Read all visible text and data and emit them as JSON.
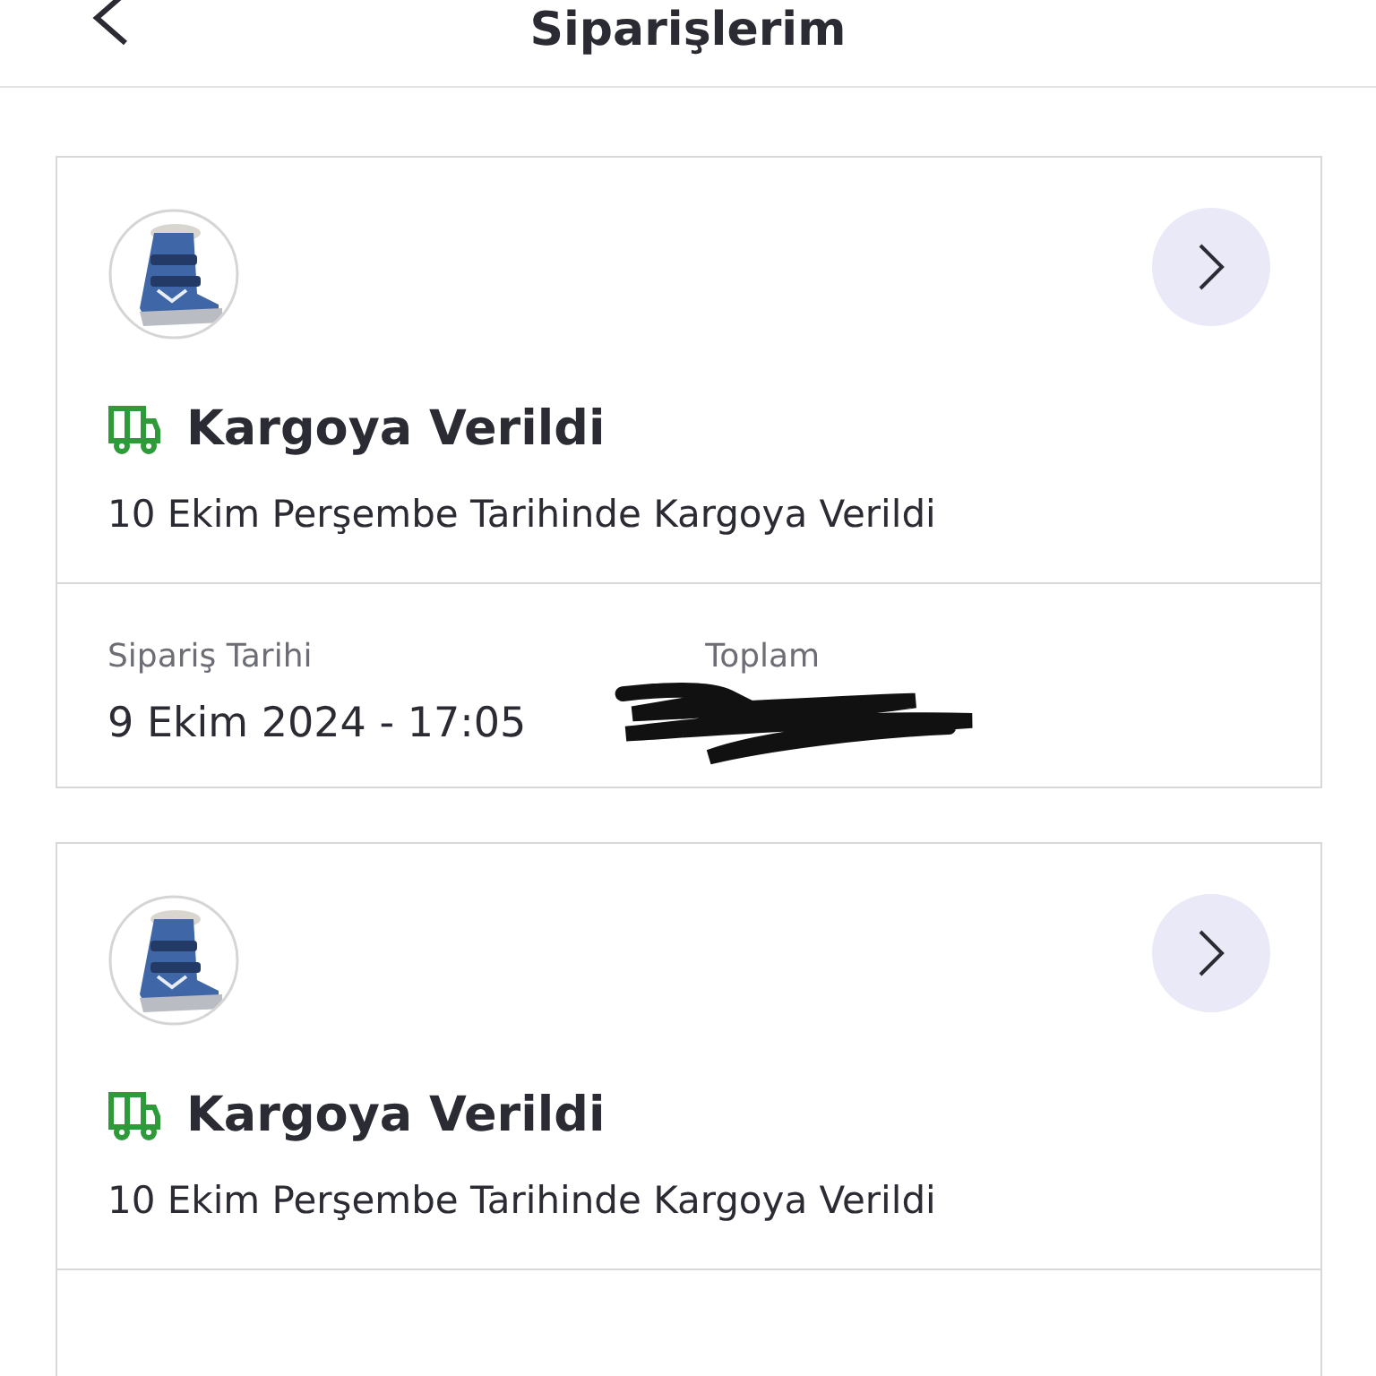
{
  "header": {
    "title": "Siparişlerim"
  },
  "orders": [
    {
      "status": "Kargoya Verildi",
      "detail": "10 Ekim Perşembe Tarihinde Kargoya Verildi",
      "date_label": "Sipariş Tarihi",
      "date": "9 Ekim 2024 - 17:05",
      "total_label": "Toplam",
      "total_redacted": true
    },
    {
      "status": "Kargoya Verildi",
      "detail": "10 Ekim Perşembe Tarihinde Kargoya Verildi"
    }
  ]
}
